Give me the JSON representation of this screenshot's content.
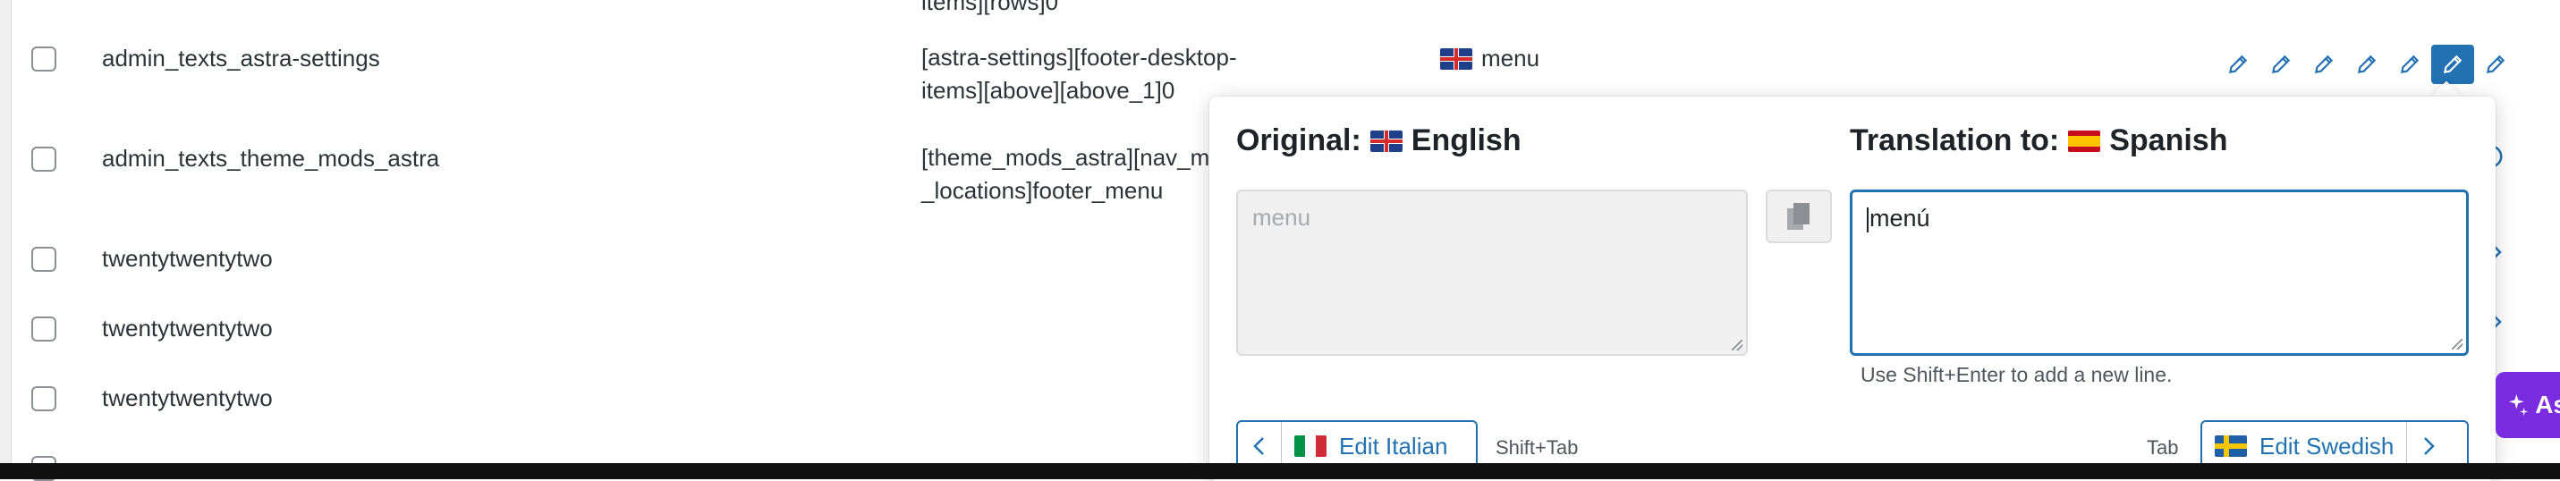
{
  "rows": [
    {
      "name": "",
      "string_lines": [
        "items][rows]0"
      ],
      "lang": ""
    },
    {
      "name": "admin_texts_astra-settings",
      "string_lines": [
        "[astra-settings][footer-desktop-",
        "items][above][above_1]0"
      ],
      "lang": "menu"
    },
    {
      "name": "admin_texts_theme_mods_astra",
      "string_lines": [
        "[theme_mods_astra][nav_m",
        "_locations]footer_menu"
      ],
      "lang": ""
    },
    {
      "name": "twentytwentytwo",
      "string_lines": [],
      "lang": ""
    },
    {
      "name": "twentytwentytwo",
      "string_lines": [],
      "lang": ""
    },
    {
      "name": "twentytwentytwo",
      "string_lines": [],
      "lang": ""
    }
  ],
  "popup": {
    "original_label": "Original:",
    "original_language": "English",
    "original_text": "menu",
    "translation_label": "Translation to:",
    "translation_language": "Spanish",
    "translation_value": "menú",
    "hint": "Use Shift+Enter to add a new line.",
    "prev_button": "Edit Italian",
    "prev_shortcut": "Shift+Tab",
    "next_button": "Edit Swedish",
    "next_shortcut": "Tab"
  },
  "assistant_badge": "As",
  "colors": {
    "accent": "#2271b1",
    "assistant": "#7b2be0"
  }
}
